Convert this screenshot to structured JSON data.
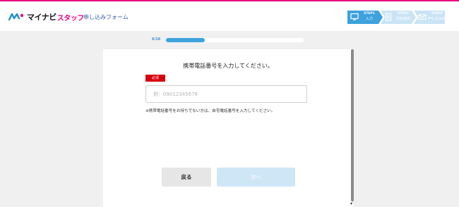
{
  "brand": {
    "logo_main": "マイナビ",
    "logo_sub": "スタッフ",
    "form_title": "申し込みフォーム",
    "accent_color": "#e5007f"
  },
  "steps": [
    {
      "num": "STEP1",
      "label": "入力",
      "icon": "monitor-icon",
      "active": true
    },
    {
      "num": "STEP2",
      "label": "内容確認",
      "icon": "document-icon",
      "active": false
    },
    {
      "num": "STEP3",
      "label": "申し込み完了",
      "icon": "envelope-icon",
      "active": false
    }
  ],
  "progress": {
    "label": "6/16",
    "fraction": 0.28
  },
  "form": {
    "question": "携帯電話番号を入力してください。",
    "required_badge": "必須",
    "phone_placeholder": "例：09012345678",
    "phone_value": "",
    "note": "※携帯電話番号をお持ちでない方は、自宅電話番号を入力してください。",
    "back_label": "戻る",
    "next_label": "次へ"
  },
  "colors": {
    "active_step": "#3da2dd",
    "inactive_step": "#c9e4f5",
    "required": "#d9000d",
    "next_disabled": "#cfe6f7"
  }
}
